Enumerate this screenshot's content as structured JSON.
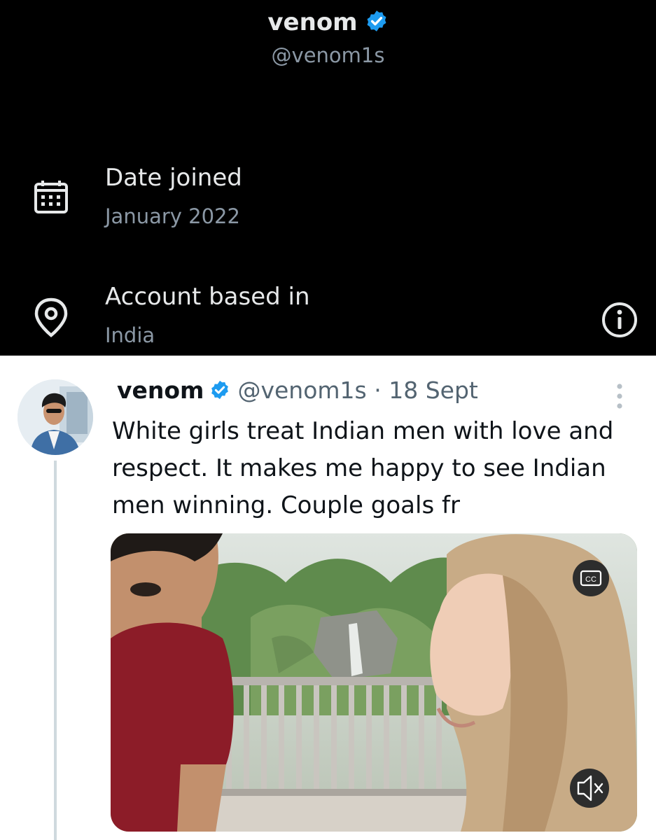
{
  "profile_header": {
    "name": "venom",
    "handle": "@venom1s"
  },
  "about": {
    "date_joined_label": "Date joined",
    "date_joined_value": "January 2022",
    "location_label": "Account based in",
    "location_value": "India"
  },
  "tweet": {
    "name": "venom",
    "handle": "@venom1s",
    "time": "· 18 Sept",
    "text": "White girls treat Indian men with love and respect. It makes me happy to see Indian men winning. Couple goals fr",
    "media": {
      "cc_label": "CC",
      "muted": true
    }
  },
  "colors": {
    "verified_badge": "#1d9bf0",
    "dark_bg": "#000000",
    "secondary_text": "#8b98a5",
    "thread_line": "#cfd9de"
  },
  "icons": {
    "calendar": "calendar-icon",
    "location": "location-pin-icon",
    "info": "info-icon",
    "more": "more-vertical-icon",
    "mute": "volume-muted-icon",
    "captions": "captions-icon"
  }
}
